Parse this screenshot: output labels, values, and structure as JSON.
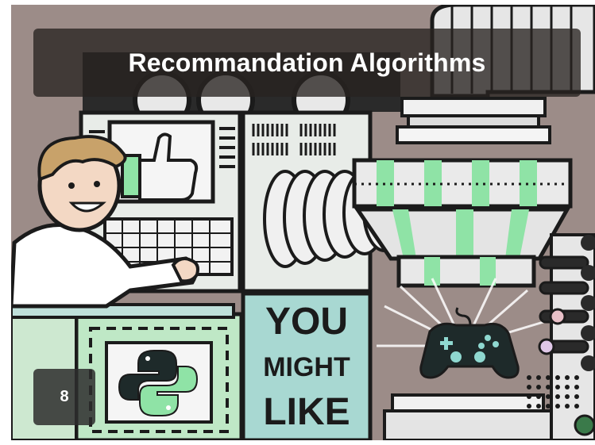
{
  "slide": {
    "title": "Recommandation Algorithms",
    "page_number": "8"
  },
  "illustration": {
    "screen_text": [
      "YOU",
      "MIGHT",
      "LIKE"
    ],
    "icons": [
      "thumbs-up-icon",
      "python-logo-icon",
      "game-controller-icon"
    ],
    "colors": {
      "background": "#9a8a86",
      "accent_green": "#8fe3a6",
      "panel_light": "#e8ece8",
      "teal": "#a8d8d2",
      "ink": "#1b1b1b"
    }
  }
}
